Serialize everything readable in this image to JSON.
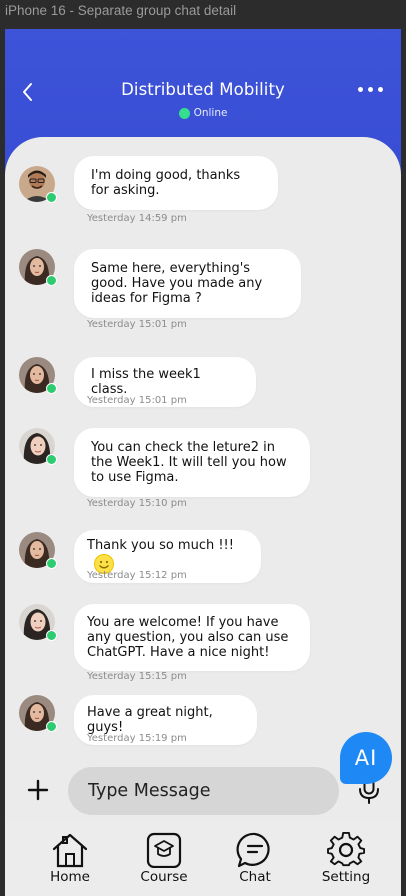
{
  "frame_label": "iPhone 16 - Separate group chat detail",
  "header": {
    "title": "Distributed Mobility",
    "status": "Online",
    "back_icon": "chevron-left-icon",
    "more_icon": "more-horizontal-icon"
  },
  "messages": [
    {
      "sender_avatar": "avatar-man",
      "text": "I'm doing good, thanks for asking.",
      "time": "Yesterday 14:59 pm"
    },
    {
      "sender_avatar": "avatar-woman-1",
      "text": "Same here, everything's good. Have you made any ideas for Figma ?",
      "time": "Yesterday 15:01 pm"
    },
    {
      "sender_avatar": "avatar-woman-1",
      "text": "I miss the week1 class.",
      "time": "Yesterday 15:01 pm"
    },
    {
      "sender_avatar": "avatar-woman-2",
      "text": "You can check the leture2 in the Week1. It will tell you how to use Figma.",
      "time": "Yesterday 15:10 pm"
    },
    {
      "sender_avatar": "avatar-woman-1",
      "text": "Thank you so much !!!",
      "time": "Yesterday 15:12 pm",
      "emoji": "smiley-emoji"
    },
    {
      "sender_avatar": "avatar-woman-2",
      "text": "You are welcome! If you have any question, you also can use ChatGPT. Have a nice night!",
      "time": "Yesterday 15:15 pm"
    },
    {
      "sender_avatar": "avatar-woman-1",
      "text": "Have a great night, guys!",
      "time": "Yesterday 15:19 pm"
    }
  ],
  "composer": {
    "placeholder": "Type Message",
    "plus_icon": "plus-icon",
    "mic_icon": "microphone-icon"
  },
  "ai_button": {
    "label": "AI"
  },
  "nav": [
    {
      "label": "Home",
      "icon": "home-icon"
    },
    {
      "label": "Course",
      "icon": "course-icon"
    },
    {
      "label": "Chat",
      "icon": "chat-icon"
    },
    {
      "label": "Setting",
      "icon": "gear-icon"
    }
  ],
  "colors": {
    "header_gradient_top": "#3d53d8",
    "header_gradient_bottom": "#1e30b3",
    "online": "#34e08e",
    "ai_button": "#1e88f5",
    "panel": "#ebebeb"
  }
}
